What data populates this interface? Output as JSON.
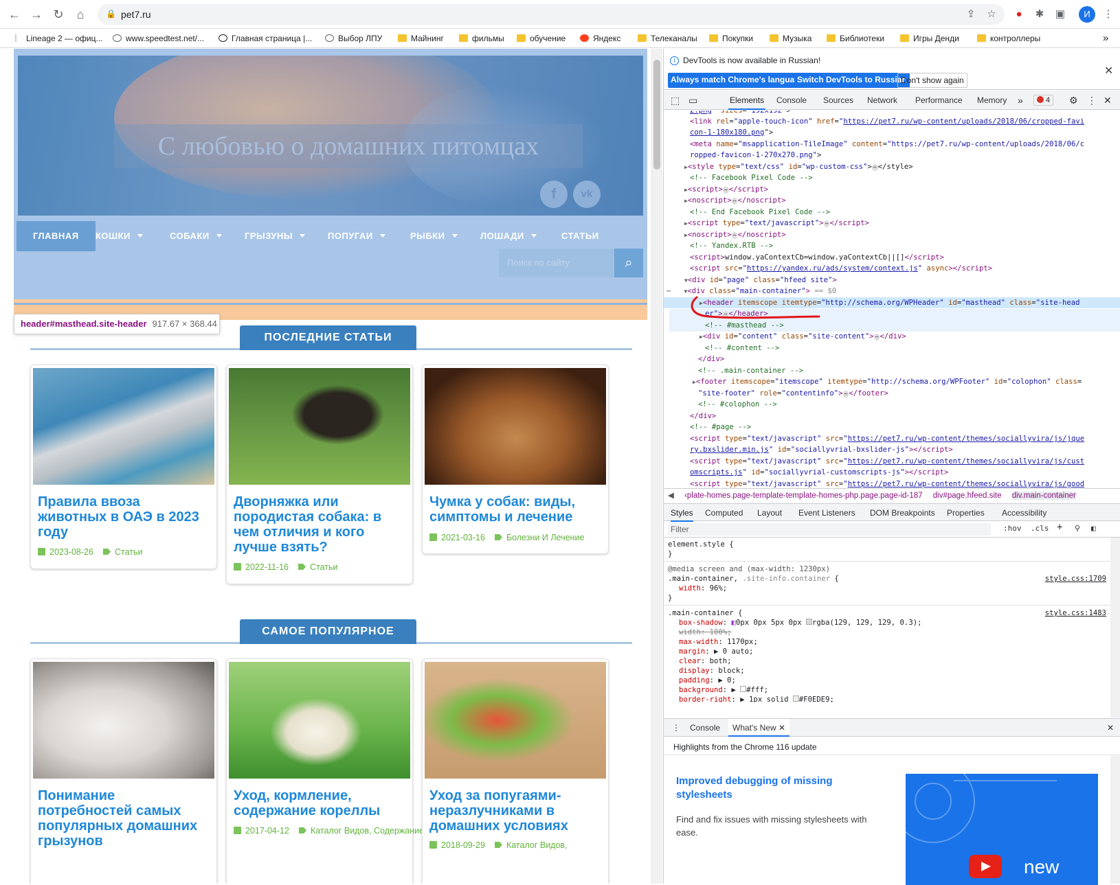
{
  "browser": {
    "url": "pet7.ru",
    "avatar_letter": "И",
    "bookmarks": [
      {
        "label": "Lineage 2 — офиц...",
        "icon": "bookmark-icon"
      },
      {
        "label": "www.speedtest.net/...",
        "icon": "speedometer-icon"
      },
      {
        "label": "Главная страница |...",
        "icon": "site-icon"
      },
      {
        "label": "Выбор ЛПУ",
        "icon": "globe-icon"
      },
      {
        "label": "Майнинг",
        "icon": "folder-icon"
      },
      {
        "label": "фильмы",
        "icon": "folder-icon"
      },
      {
        "label": "обучение",
        "icon": "folder-icon"
      },
      {
        "label": "Яндекс",
        "icon": "yandex-icon"
      },
      {
        "label": "Телеканалы",
        "icon": "folder-icon"
      },
      {
        "label": "Покупки",
        "icon": "folder-icon"
      },
      {
        "label": "Музыка",
        "icon": "folder-icon"
      },
      {
        "label": "Библиотеки",
        "icon": "folder-icon"
      },
      {
        "label": "Игры Денди",
        "icon": "folder-icon"
      },
      {
        "label": "контроллеры",
        "icon": "folder-icon"
      }
    ],
    "overflow": "»"
  },
  "site": {
    "title": "С любовью о домашних питомцах",
    "social": {
      "facebook": "f",
      "vk": "vk"
    },
    "nav": [
      {
        "label": "ГЛАВНАЯ",
        "caret": false
      },
      {
        "label": "КОШКИ",
        "caret": true
      },
      {
        "label": "СОБАКИ",
        "caret": true
      },
      {
        "label": "ГРЫЗУНЫ",
        "caret": true
      },
      {
        "label": "ПОПУГАИ",
        "caret": true
      },
      {
        "label": "РЫБКИ",
        "caret": true
      },
      {
        "label": "ЛОШАДИ",
        "caret": true
      },
      {
        "label": "СТАТЬИ",
        "caret": false
      }
    ],
    "search_placeholder": "Поиск по сайту",
    "tooltip": {
      "tag": "header#masthead.site-header",
      "size": "917.67 × 368.44"
    },
    "section_latest": "ПОСЛЕДНИЕ СТАТЬИ",
    "section_popular": "САМОЕ ПОПУЛЯРНОЕ",
    "latest": [
      {
        "title": "Правила ввоза животных в ОАЭ в 2023 году",
        "date": "2023-08-26",
        "category": "Статьи"
      },
      {
        "title": "Дворняжка или породистая собака: в чем отличия и кого лучше взять?",
        "date": "2022-11-16",
        "category": "Статьи"
      },
      {
        "title": "Чумка у собак: виды, симптомы и лечение",
        "date": "2021-03-16",
        "category": "Болезни И Лечение"
      }
    ],
    "popular": [
      {
        "title": "Понимание потребностей самых популярных домашних грызунов",
        "date": "",
        "category": ""
      },
      {
        "title": "Уход, кормление, содержание кореллы",
        "date": "2017-04-12",
        "category": "Каталог Видов, Содержание И Уход"
      },
      {
        "title": "Уход за попугаями-неразлучниками в домашних условиях",
        "date": "2018-09-29",
        "category": "Каталог Видов,"
      }
    ]
  },
  "devtools": {
    "info": "DevTools is now available in Russian!",
    "btn_match": "Always match Chrome's language",
    "btn_switch": "Switch DevTools to Russian",
    "btn_dont": "Don't show again",
    "tabs": [
      "Elements",
      "Console",
      "Sources",
      "Network",
      "Performance",
      "Memory"
    ],
    "more": "»",
    "error_count": "4",
    "crumbs": [
      "‹plate-homes.page-template-template-homes-php.page.page-id-187",
      "div#page.hfeed.site",
      "div.main-container"
    ],
    "style_tabs": [
      "Styles",
      "Computed",
      "Layout",
      "Event Listeners",
      "DOM Breakpoints",
      "Properties",
      "Accessibility"
    ],
    "filter_placeholder": "Filter",
    "filter_hov": ":hov",
    "filter_cls": ".cls",
    "drawer_tabs": [
      "Console",
      "What's New"
    ],
    "highlights": "Highlights from the Chrome 116 update",
    "wn_title": "Improved debugging of missing stylesheets",
    "wn_text": "Find and fix issues with missing stylesheets with ease.",
    "wn_badge": "new"
  },
  "colors": {
    "accent": "#1a73e8",
    "site_blue": "#3a80bf",
    "link": "#1e88d8",
    "meta_green": "#61b33b"
  }
}
